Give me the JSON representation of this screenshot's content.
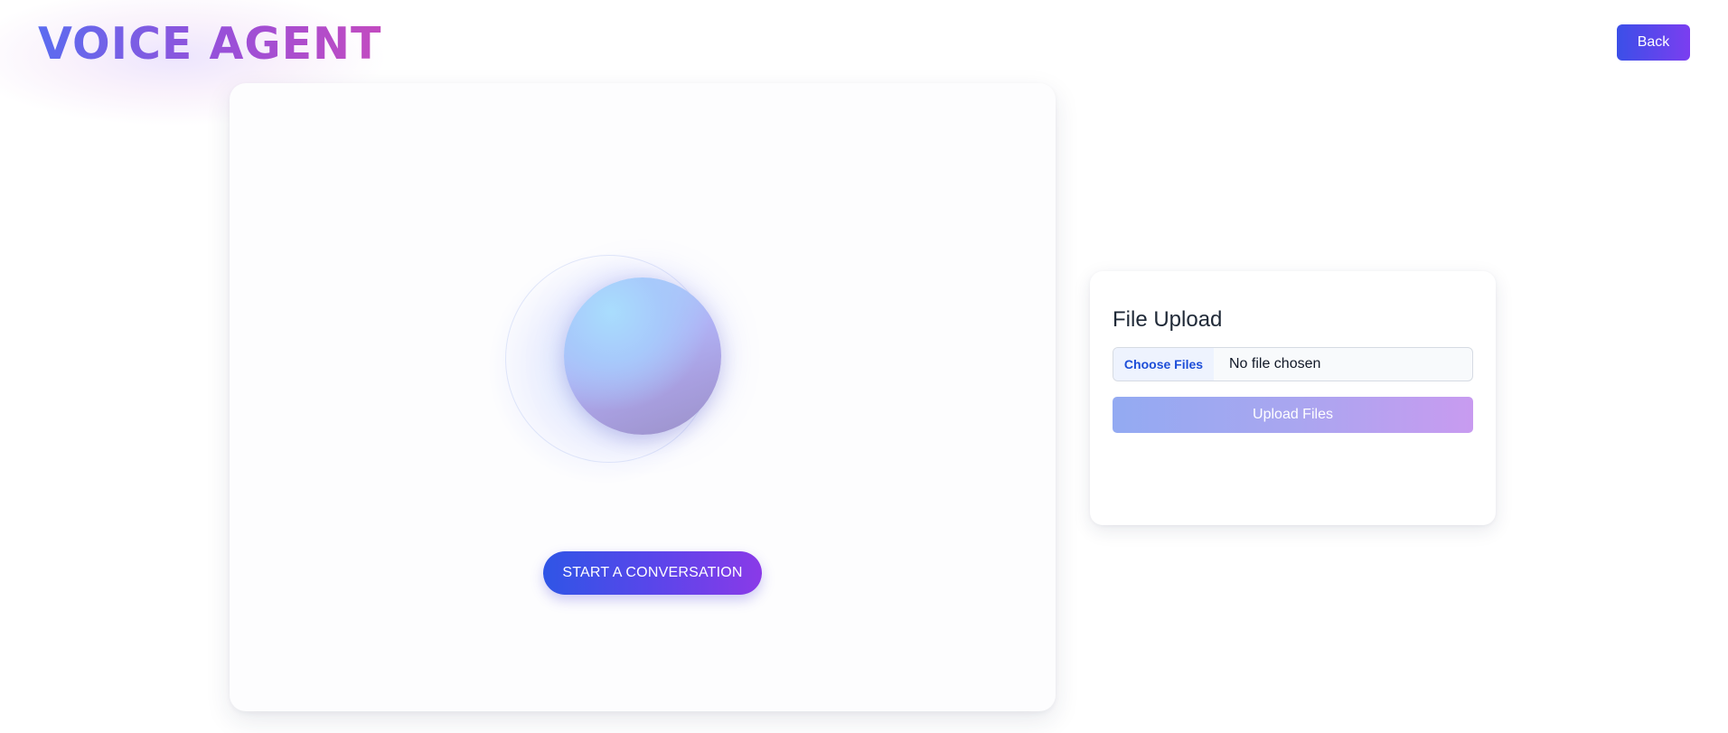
{
  "header": {
    "title": "VOICE AGENT",
    "back_label": "Back"
  },
  "voice_panel": {
    "start_label": "START A CONVERSATION"
  },
  "upload_panel": {
    "title": "File Upload",
    "choose_label": "Choose Files",
    "file_status": "No file chosen",
    "upload_label": "Upload Files"
  },
  "colors": {
    "accent_blue": "#3b4fe8",
    "accent_purple": "#8a3ae8",
    "title_gradient_start": "#5b6cf0",
    "title_gradient_end": "#c34bc0"
  }
}
